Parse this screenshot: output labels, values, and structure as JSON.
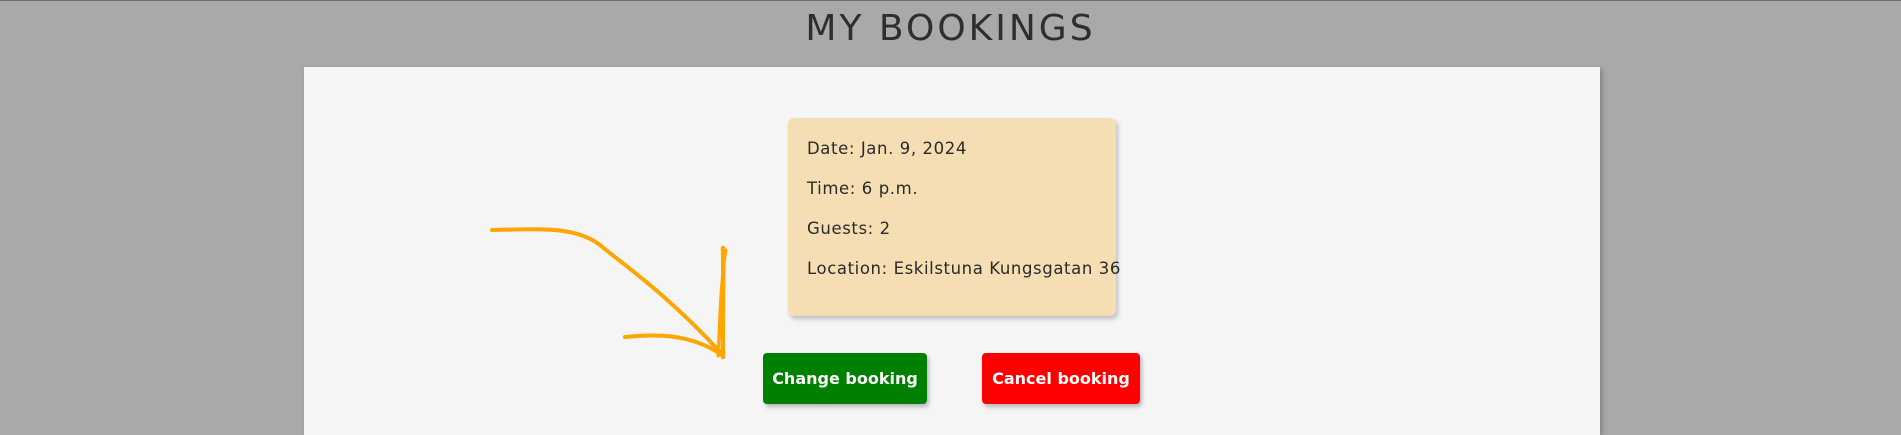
{
  "page": {
    "title": "MY BOOKINGS"
  },
  "booking": {
    "date": "Date: Jan. 9, 2024",
    "time": "Time: 6 p.m.",
    "guests": "Guests: 2",
    "location": "Location: Eskilstuna Kungsgatan 36"
  },
  "actions": {
    "change_label": "Change booking",
    "cancel_label": "Cancel booking"
  },
  "colors": {
    "background": "#a9a9a9",
    "panel": "#f5f5f5",
    "card": "#f5deb3",
    "change_button": "#008000",
    "cancel_button": "#ff0000",
    "annotation_arrow": "#ffa500"
  },
  "annotation": {
    "icon": "hand-drawn-arrow-icon"
  }
}
